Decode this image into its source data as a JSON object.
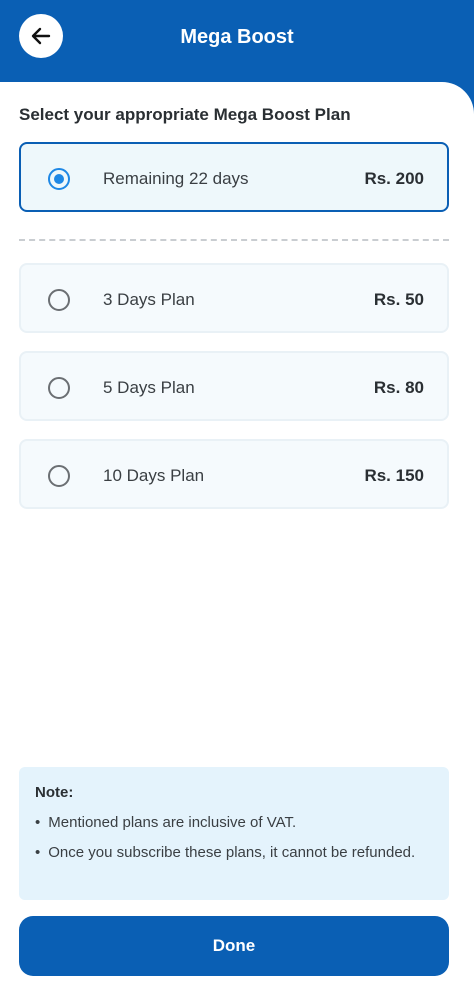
{
  "header": {
    "title": "Mega Boost",
    "back_icon": "arrow-left-icon"
  },
  "main": {
    "heading": "Select your appropriate Mega Boost Plan",
    "current_plan": {
      "name": "Remaining 22 days",
      "price": "Rs. 200",
      "selected": true
    },
    "plans": [
      {
        "name": "3 Days Plan",
        "price": "Rs. 50",
        "selected": false
      },
      {
        "name": "5 Days Plan",
        "price": "Rs. 80",
        "selected": false
      },
      {
        "name": "10 Days Plan",
        "price": "Rs. 150",
        "selected": false
      }
    ]
  },
  "note": {
    "title": "Note:",
    "bullet": "•",
    "lines": [
      "Mentioned plans are inclusive of VAT.",
      "Once you subscribe these plans, it cannot be refunded."
    ]
  },
  "footer": {
    "done_label": "Done"
  },
  "colors": {
    "brand": "#0a5fb4",
    "radio_active": "#1e88e5",
    "note_bg": "#e4f3fc"
  }
}
